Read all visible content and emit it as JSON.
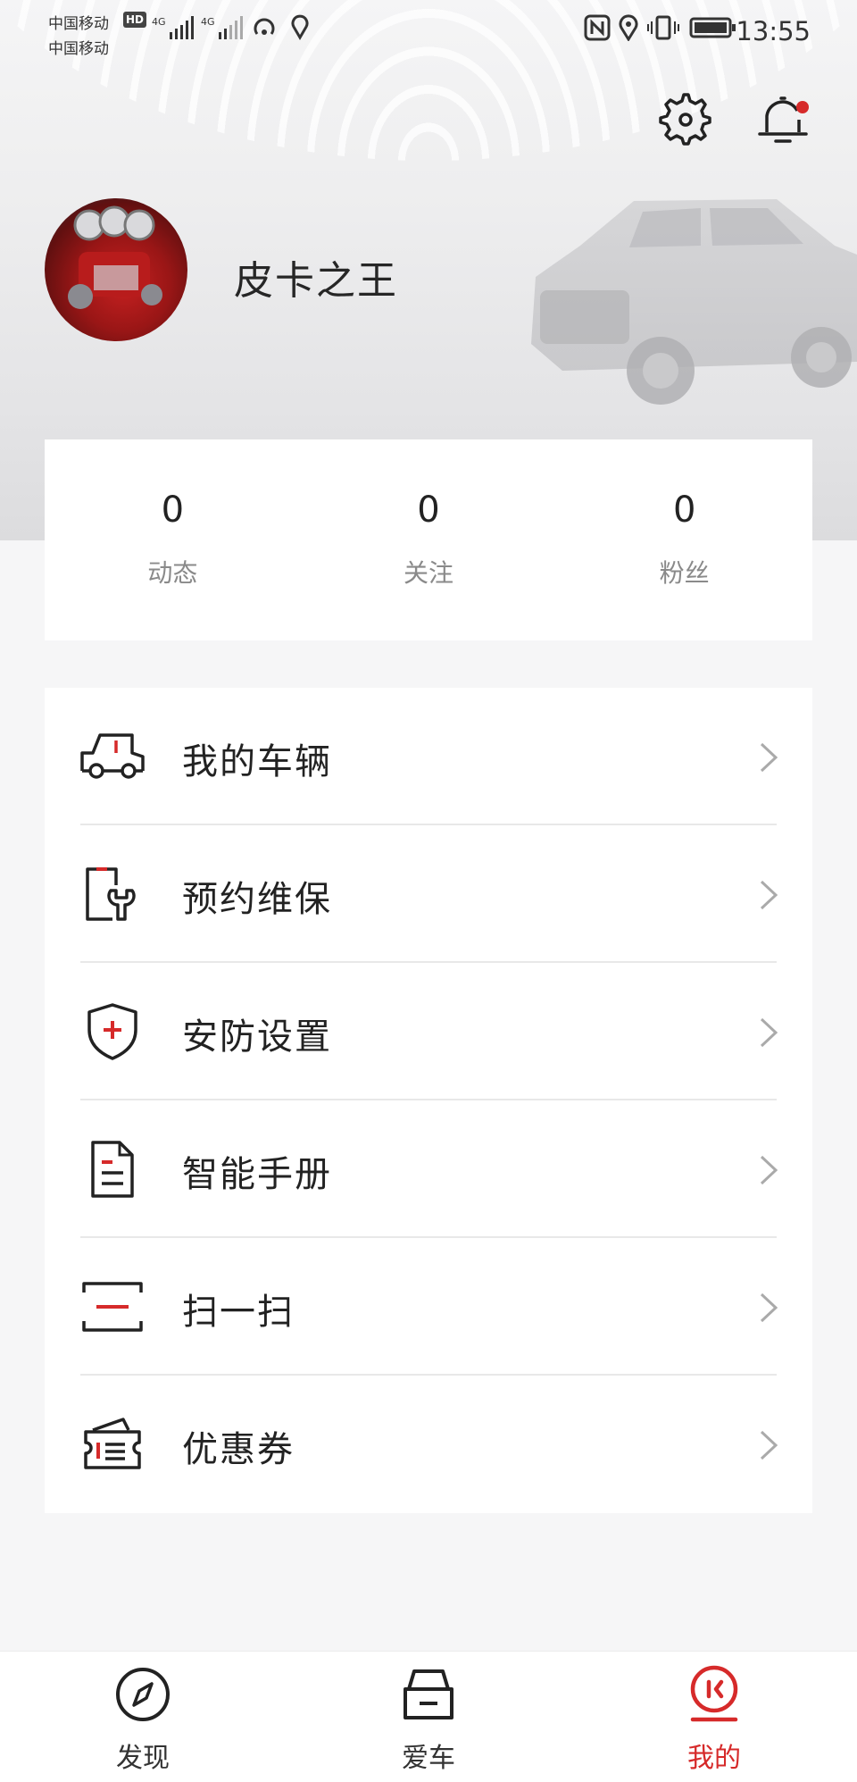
{
  "status_bar": {
    "carrier_1": "中国移动",
    "carrier_2": "中国移动",
    "hd_badge": "HD",
    "network_1": "4G",
    "network_2": "4G",
    "time": "13:55"
  },
  "header": {
    "username": "皮卡之王",
    "settings_icon": "gear-icon",
    "notification_icon": "bell-icon",
    "has_unread_notification": true
  },
  "stats": [
    {
      "value": "0",
      "label": "动态"
    },
    {
      "value": "0",
      "label": "关注"
    },
    {
      "value": "0",
      "label": "粉丝"
    }
  ],
  "menu": [
    {
      "label": "我的车辆",
      "icon": "truck-icon"
    },
    {
      "label": "预约维保",
      "icon": "maintenance-wrench-icon"
    },
    {
      "label": "安防设置",
      "icon": "shield-plus-icon"
    },
    {
      "label": "智能手册",
      "icon": "document-icon"
    },
    {
      "label": "扫一扫",
      "icon": "scan-icon"
    },
    {
      "label": "优惠券",
      "icon": "coupon-icon"
    }
  ],
  "tabs": [
    {
      "label": "发现",
      "icon": "compass-icon",
      "active": false
    },
    {
      "label": "爱车",
      "icon": "car-icon",
      "active": false
    },
    {
      "label": "我的",
      "icon": "profile-icon",
      "active": true
    }
  ],
  "colors": {
    "accent": "#d62a2a",
    "text": "#222222",
    "muted": "#8a8a8a",
    "background": "#f6f6f7"
  }
}
